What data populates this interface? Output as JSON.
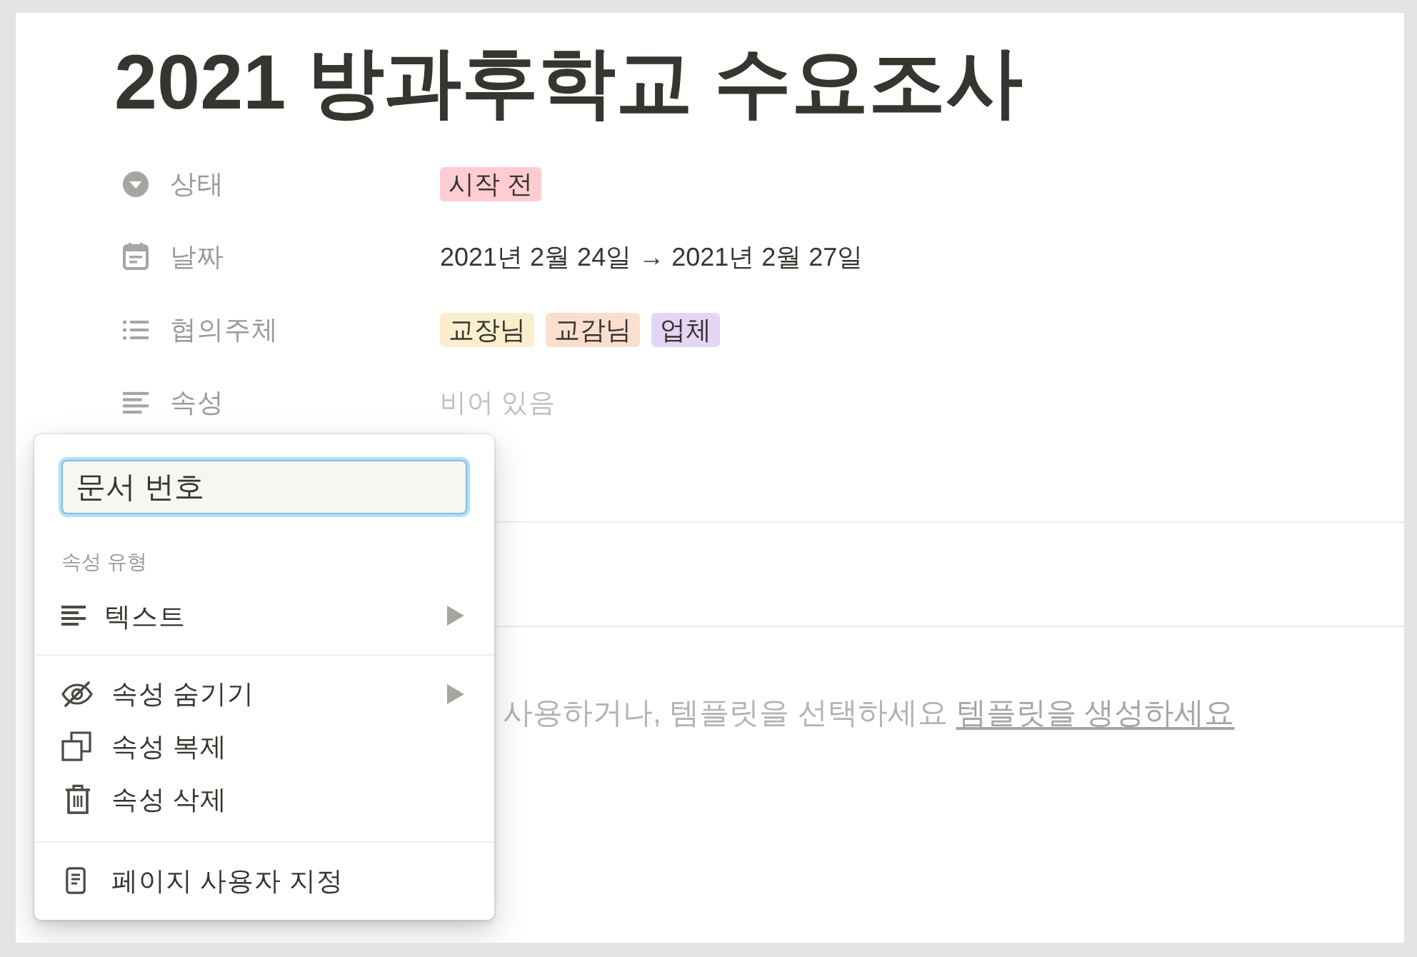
{
  "title": "2021 방과후학교 수요조사",
  "properties": [
    {
      "kind": "status",
      "label": "상태",
      "tags": [
        {
          "text": "시작 전",
          "color": "#ffccd1"
        }
      ]
    },
    {
      "kind": "date",
      "label": "날짜",
      "value": "2021년 2월 24일 → 2021년 2월 27일"
    },
    {
      "kind": "multi_select",
      "label": "협의주체",
      "tags": [
        {
          "text": "교장님",
          "color": "#fbeecc"
        },
        {
          "text": "교감님",
          "color": "#fbdfcd"
        },
        {
          "text": "업체",
          "color": "#e3d6f5"
        }
      ]
    },
    {
      "kind": "text",
      "label": "속성",
      "placeholder": "비어 있음"
    }
  ],
  "empty_hint": {
    "text": "사용하거나, 템플릿을 선택하세요",
    "link": "템플릿을 생성하세요"
  },
  "property_menu": {
    "name_field": {
      "value": "문서 번호"
    },
    "section_label": "속성 유형",
    "groups": [
      [
        {
          "kind": "type_text",
          "label": "텍스트",
          "submenu": true
        }
      ],
      [
        {
          "kind": "hide",
          "label": "속성 숨기기",
          "submenu": true
        },
        {
          "kind": "duplicate",
          "label": "속성 복제",
          "submenu": false
        },
        {
          "kind": "delete",
          "label": "속성 삭제",
          "submenu": false
        }
      ],
      [
        {
          "kind": "customize_page",
          "label": "페이지 사용자 지정",
          "submenu": false
        }
      ]
    ]
  }
}
